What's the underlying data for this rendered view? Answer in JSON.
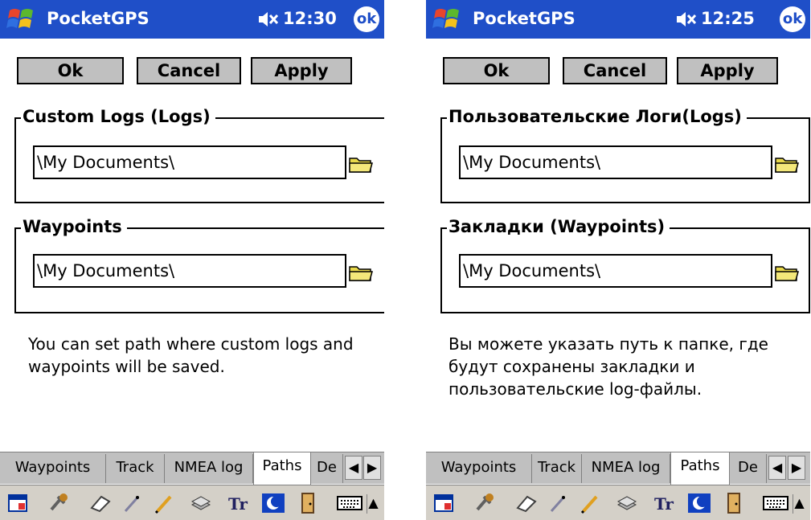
{
  "screens": [
    {
      "app_title": "PocketGPS",
      "time": "12:30",
      "ok_icon": "ok",
      "buttons": {
        "ok": "Ok",
        "cancel": "Cancel",
        "apply": "Apply"
      },
      "logs_group": {
        "legend": "Custom Logs (Logs)",
        "path": "\\My Documents\\"
      },
      "waypoints_group": {
        "legend": "Waypoints",
        "path": "\\My Documents\\"
      },
      "help_text": "You can set path where custom logs and waypoints will be saved.",
      "tabs": [
        "Waypoints",
        "Track",
        "NMEA log",
        "Paths",
        "De"
      ],
      "active_tab": "Paths",
      "scroll_left": "◀",
      "scroll_right": "▶"
    },
    {
      "app_title": "PocketGPS",
      "time": "12:25",
      "ok_icon": "ok",
      "buttons": {
        "ok": "Ok",
        "cancel": "Cancel",
        "apply": "Apply"
      },
      "logs_group": {
        "legend": "Пользовательские Логи(Logs)",
        "path": "\\My Documents\\"
      },
      "waypoints_group": {
        "legend": "Закладки (Waypoints)",
        "path": "\\My Documents\\"
      },
      "help_text": "Вы можете указать путь к папке, где будут сохранены закладки и пользовательские log-файлы.",
      "tabs": [
        "Waypoints",
        "Track",
        "NMEA log",
        "Paths",
        "De"
      ],
      "active_tab": "Paths",
      "scroll_left": "◀",
      "scroll_right": "▶"
    }
  ],
  "colors": {
    "titlebar": "#1f4fc8",
    "button_face": "#c0c0c0",
    "folder": "#e8d84a"
  },
  "icons": [
    "windows-start-icon",
    "speaker-muted-icon",
    "ok-icon",
    "folder-icon",
    "calendar-icon",
    "tools-icon",
    "eraser-icon",
    "pen-icon",
    "stack-icon",
    "text-icon",
    "moon-icon",
    "door-icon",
    "keyboard-icon"
  ],
  "sip_arrow": "▲"
}
